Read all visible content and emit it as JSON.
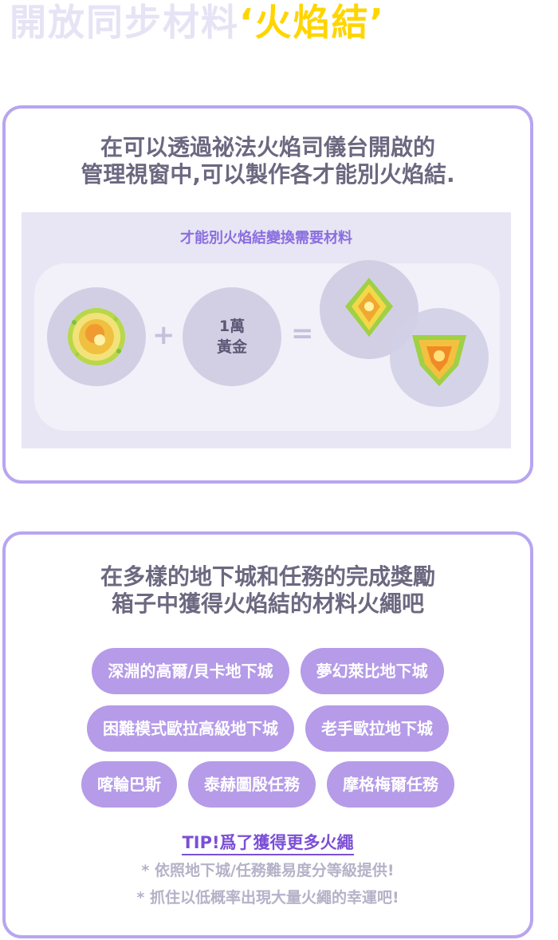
{
  "headline": {
    "main": "開放同步材料",
    "highlight": "‘火焰結’"
  },
  "card1": {
    "line1": "在可以透過祕法火焰司儀台開啟的",
    "line2": "管理視窗中,可以製作各才能別火焰結.",
    "panel_title": "才能別火焰結變換需要材料",
    "gold_line1": "1萬",
    "gold_line2": "黃金",
    "plus": "+",
    "equals": "="
  },
  "card2": {
    "line1": "在多樣的地下城和任務的完成獎勵",
    "line2": "箱子中獲得火焰結的材料火繩吧",
    "tags_row1": [
      "深淵的高爾/貝卡地下城",
      "夢幻萊比地下城"
    ],
    "tags_row2": [
      "困難模式歐拉高級地下城",
      "老手歐拉地下城"
    ],
    "tags_row3": [
      "喀輪巴斯",
      "泰赫圖殷任務",
      "摩格梅爾任務"
    ],
    "tip_title": "TIP!爲了獲得更多火繩",
    "tip1": "* 依照地下城/任務難易度分等級提供!",
    "tip2": "* 抓住以低概率出現大量火繩的幸運吧!"
  }
}
